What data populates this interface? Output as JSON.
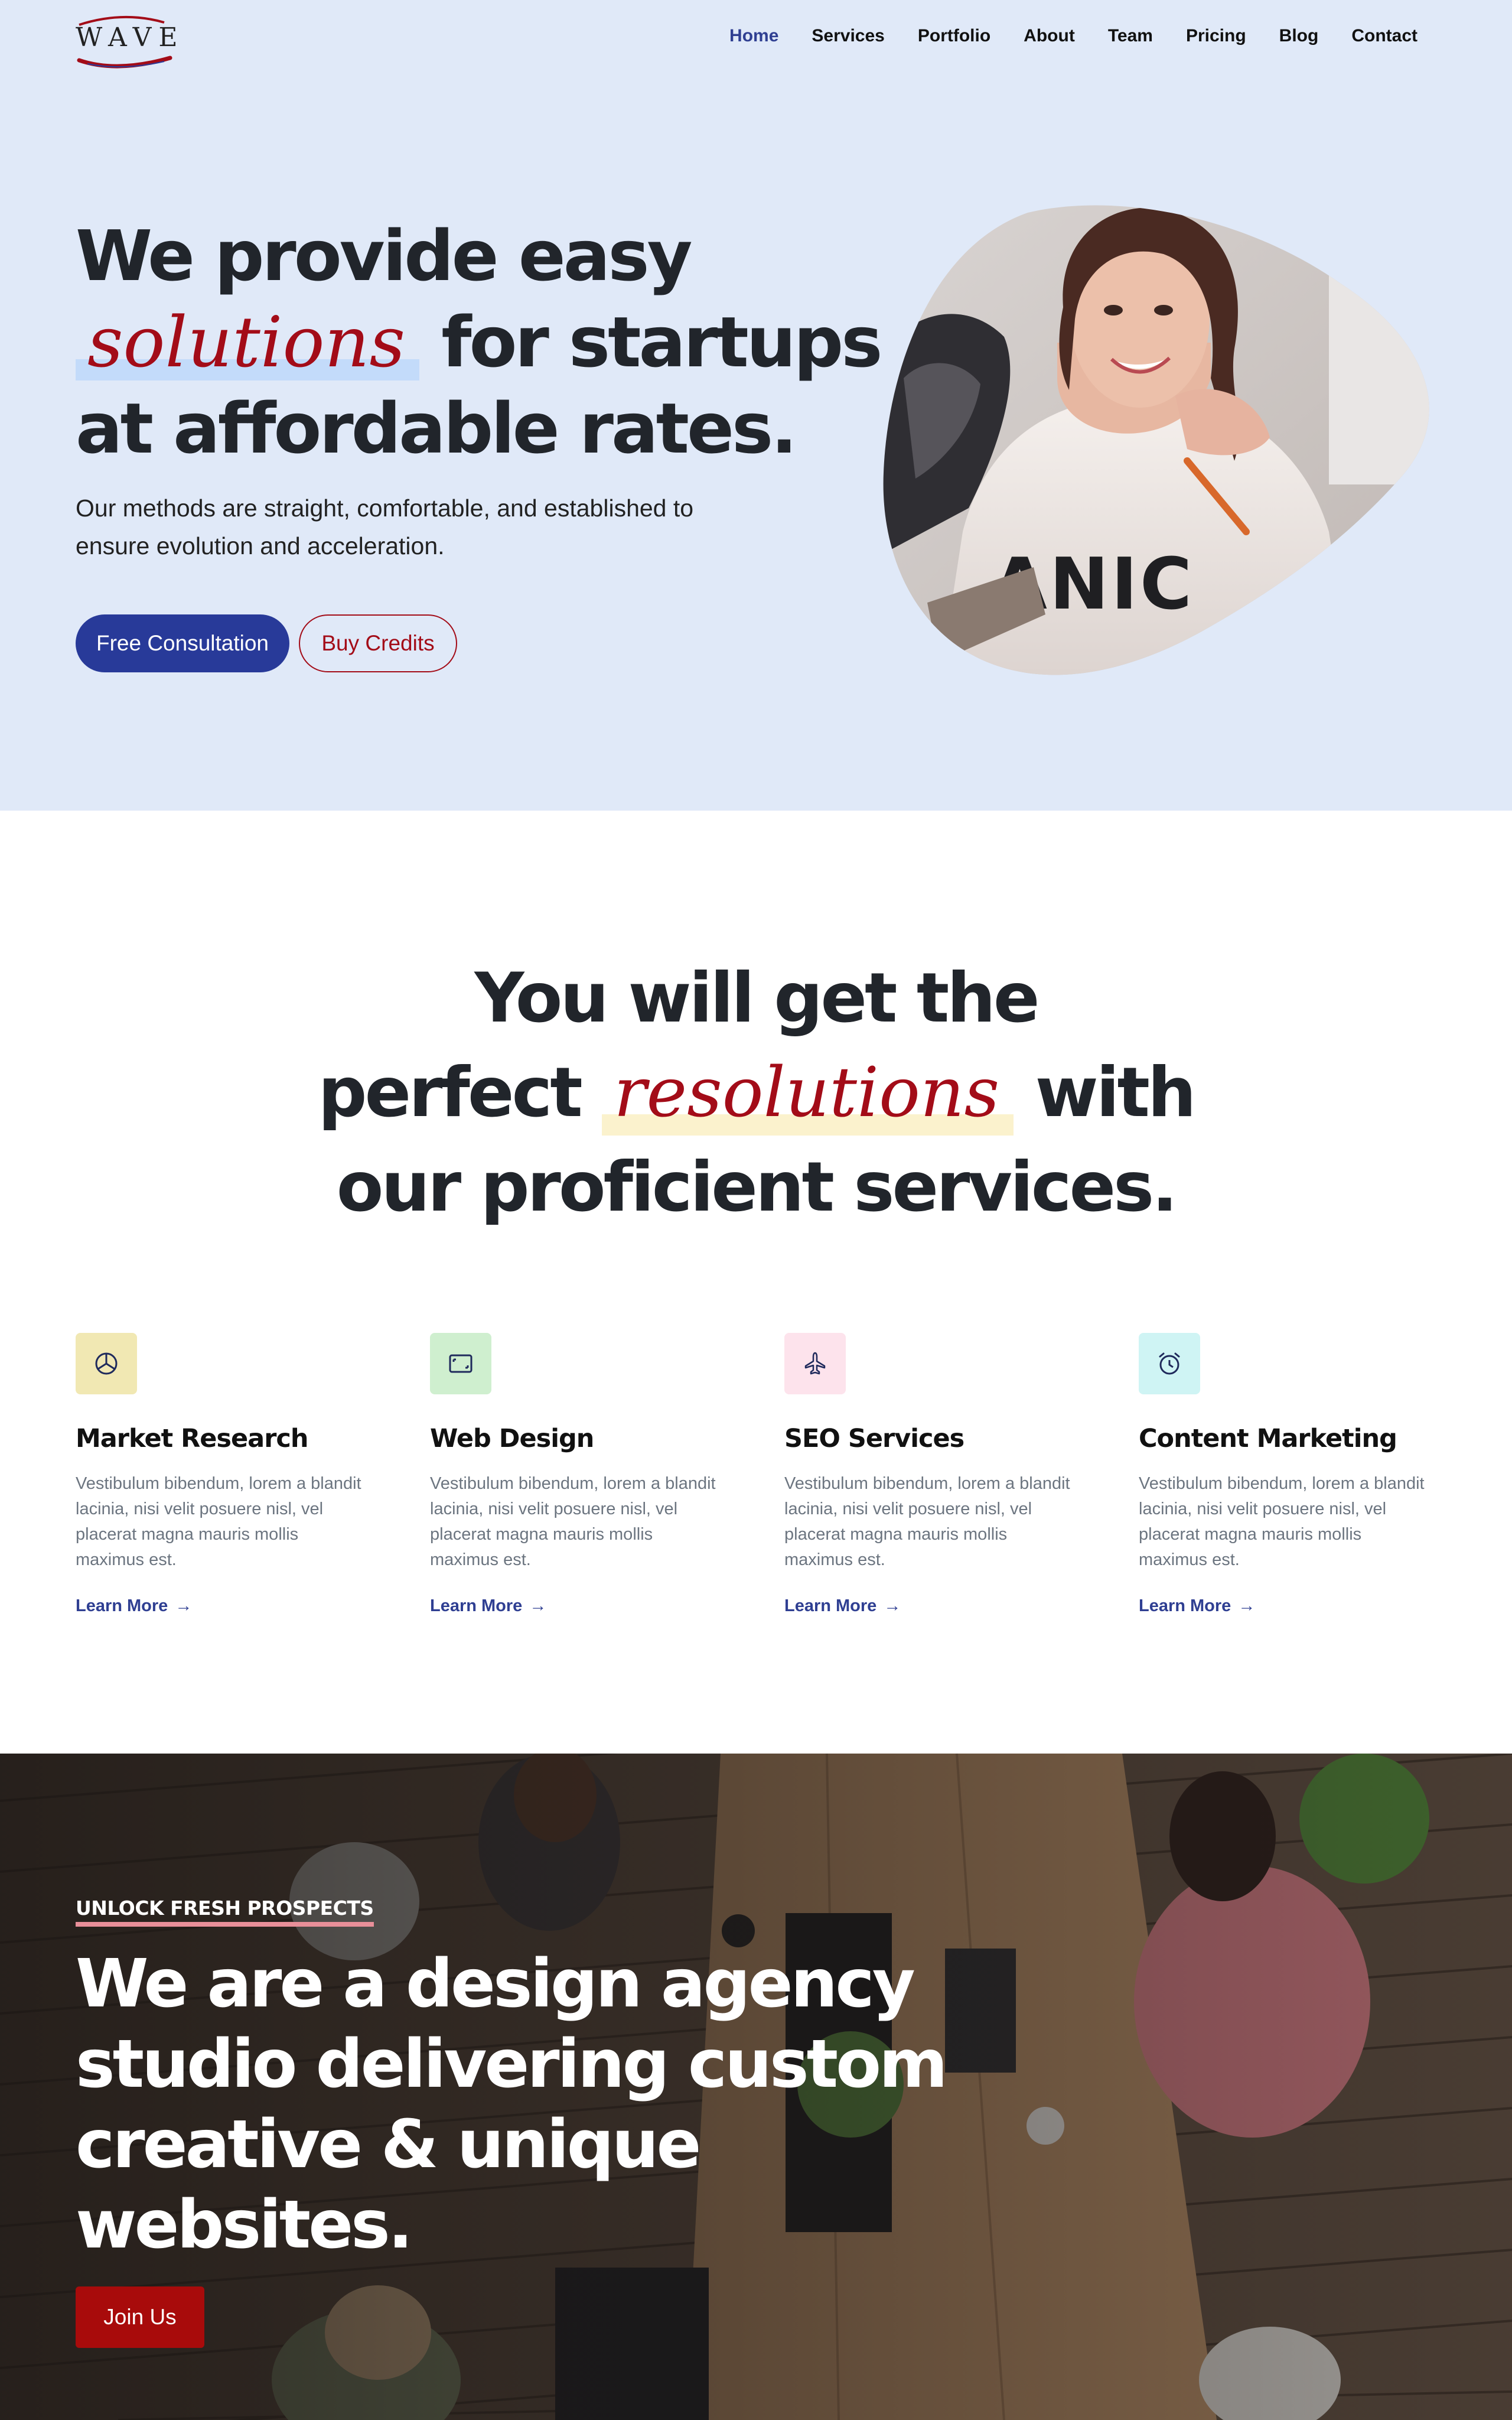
{
  "brand": {
    "logo_text": "WAVE",
    "accent_blue": "#283a99",
    "accent_red": "#a30c18"
  },
  "nav": {
    "items": [
      {
        "label": "Home",
        "active": true
      },
      {
        "label": "Services"
      },
      {
        "label": "Portfolio"
      },
      {
        "label": "About"
      },
      {
        "label": "Team"
      },
      {
        "label": "Pricing"
      },
      {
        "label": "Blog"
      },
      {
        "label": "Contact"
      }
    ]
  },
  "hero": {
    "title_line1": "We provide easy",
    "title_script": "solutions",
    "title_line2_rest": "for startups",
    "title_line3": "at affordable rates.",
    "subtitle": "Our methods are straight, comfortable, and established to ensure evolution and acceleration.",
    "primary_button": "Free Consultation",
    "secondary_button": "Buy Credits"
  },
  "services": {
    "title_line1": "You will get the",
    "title_line2_pre": "perfect",
    "title_script": "resolutions",
    "title_line2_post": "with",
    "title_line3": "our proficient services.",
    "cards": [
      {
        "title": "Market Research",
        "icon": "pie-chart-icon",
        "icon_bg": "#f1e8b3",
        "text": "Vestibulum bibendum, lorem a blandit lacinia, nisi velit posuere nisl, vel placerat magna mauris mollis maximus est.",
        "link": "Learn More"
      },
      {
        "title": "Web Design",
        "icon": "browser-window-icon",
        "icon_bg": "#cfefcf",
        "text": "Vestibulum bibendum, lorem a blandit lacinia, nisi velit posuere nisl, vel placerat magna mauris mollis maximus est.",
        "link": "Learn More"
      },
      {
        "title": "SEO Services",
        "icon": "airplane-icon",
        "icon_bg": "#fde3ec",
        "text": "Vestibulum bibendum, lorem a blandit lacinia, nisi velit posuere nisl, vel placerat magna mauris mollis maximus est.",
        "link": "Learn More"
      },
      {
        "title": "Content Marketing",
        "icon": "alarm-clock-icon",
        "icon_bg": "#cff4f4",
        "text": "Vestibulum bibendum, lorem a blandit lacinia, nisi velit posuere nisl, vel placerat magna mauris mollis maximus est.",
        "link": "Learn More"
      }
    ]
  },
  "agency": {
    "eyebrow": "UNLOCK FRESH PROSPECTS",
    "title_line1": "We are a design agency",
    "title_line2": "studio delivering custom",
    "title_line3": "creative & unique",
    "title_line4": "websites.",
    "button": "Join Us"
  }
}
